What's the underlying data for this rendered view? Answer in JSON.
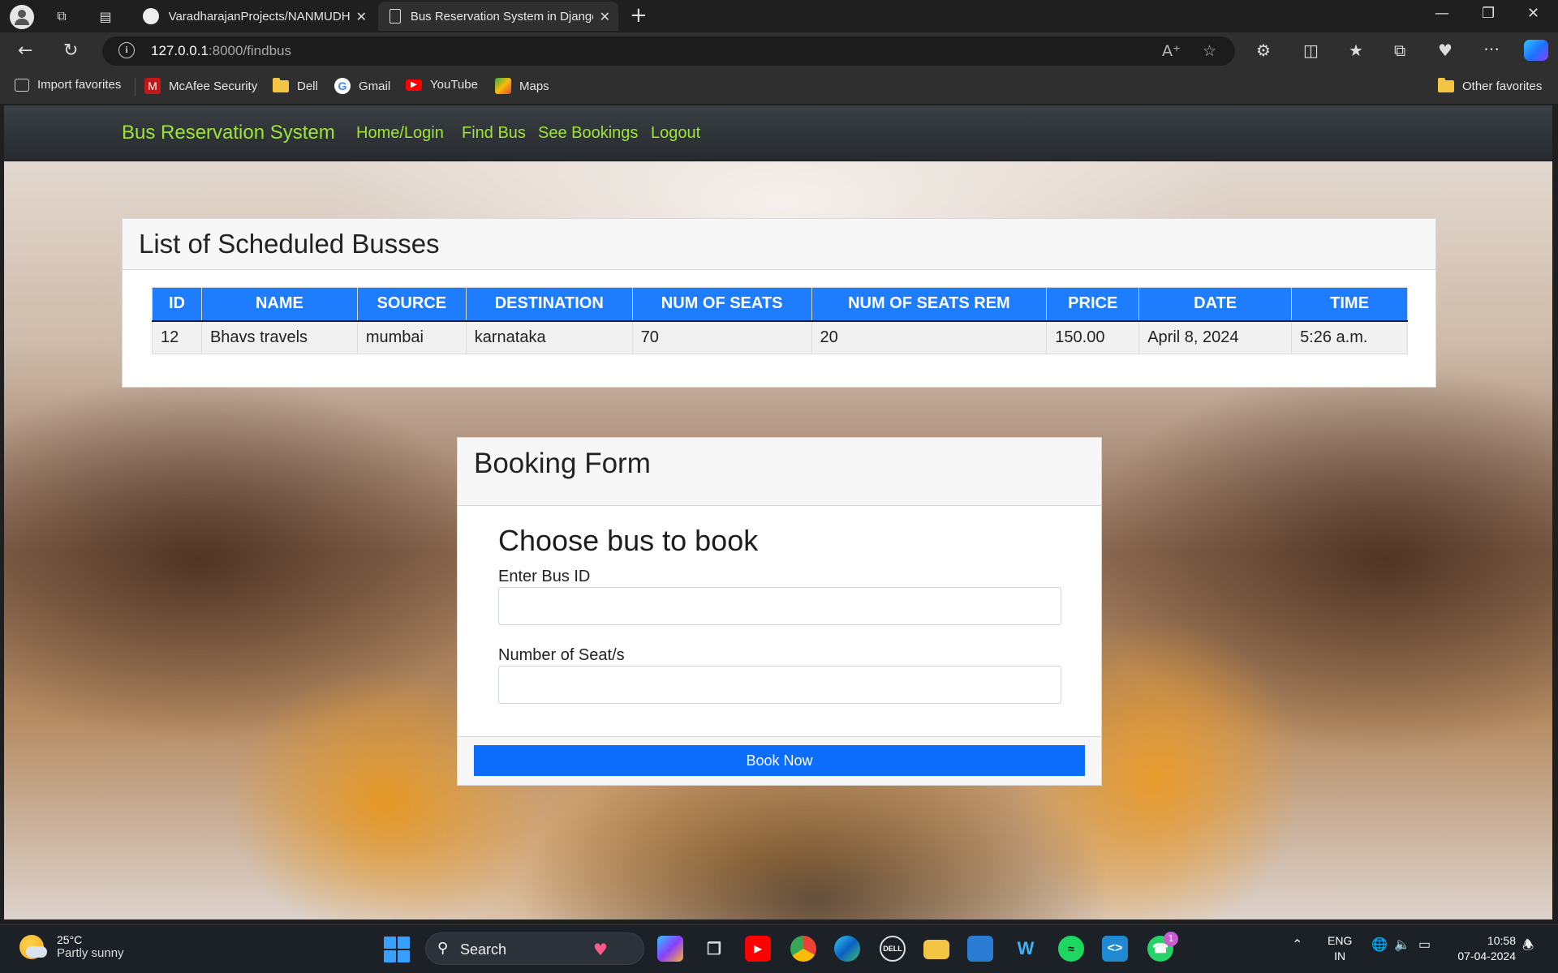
{
  "browser": {
    "tabs": [
      {
        "title": "VaradharajanProjects/NANMUDHALVAN"
      },
      {
        "title": "Bus Reservation System in Django"
      }
    ],
    "url_host": "127.0.0.1",
    "url_path": ":8000/findbus",
    "favorites": [
      "Import favorites",
      "McAfee Security",
      "Dell",
      "Gmail",
      "YouTube",
      "Maps"
    ],
    "other_favorites": "Other favorites"
  },
  "site": {
    "brand": "Bus Reservation System",
    "nav": [
      "Home/Login",
      "Find Bus",
      "See Bookings",
      "Logout"
    ]
  },
  "schedule": {
    "title": "List of Scheduled Busses",
    "columns": [
      "ID",
      "NAME",
      "SOURCE",
      "DESTINATION",
      "NUM OF SEATS",
      "NUM OF SEATS REM",
      "PRICE",
      "DATE",
      "TIME"
    ],
    "rows": [
      [
        "12",
        "Bhavs travels",
        "mumbai",
        "karnataka",
        "70",
        "20",
        "150.00",
        "April 8, 2024",
        "5:26 a.m."
      ]
    ]
  },
  "booking": {
    "header": "Booking Form",
    "title": "Choose bus to book",
    "bus_id_label": "Enter Bus ID",
    "bus_id_value": "",
    "seats_label": "Number of Seat/s",
    "seats_value": "",
    "submit_label": "Book Now"
  },
  "taskbar": {
    "temperature": "25°C",
    "condition": "Partly sunny",
    "search_label": "Search",
    "language_1": "ENG",
    "language_2": "IN",
    "time": "10:58",
    "date": "07-04-2024",
    "whatsapp_badge": "1"
  },
  "colors": {
    "nav_text": "#9be635",
    "table_header": "#1e7dfe",
    "primary_button": "#0d6efd"
  }
}
